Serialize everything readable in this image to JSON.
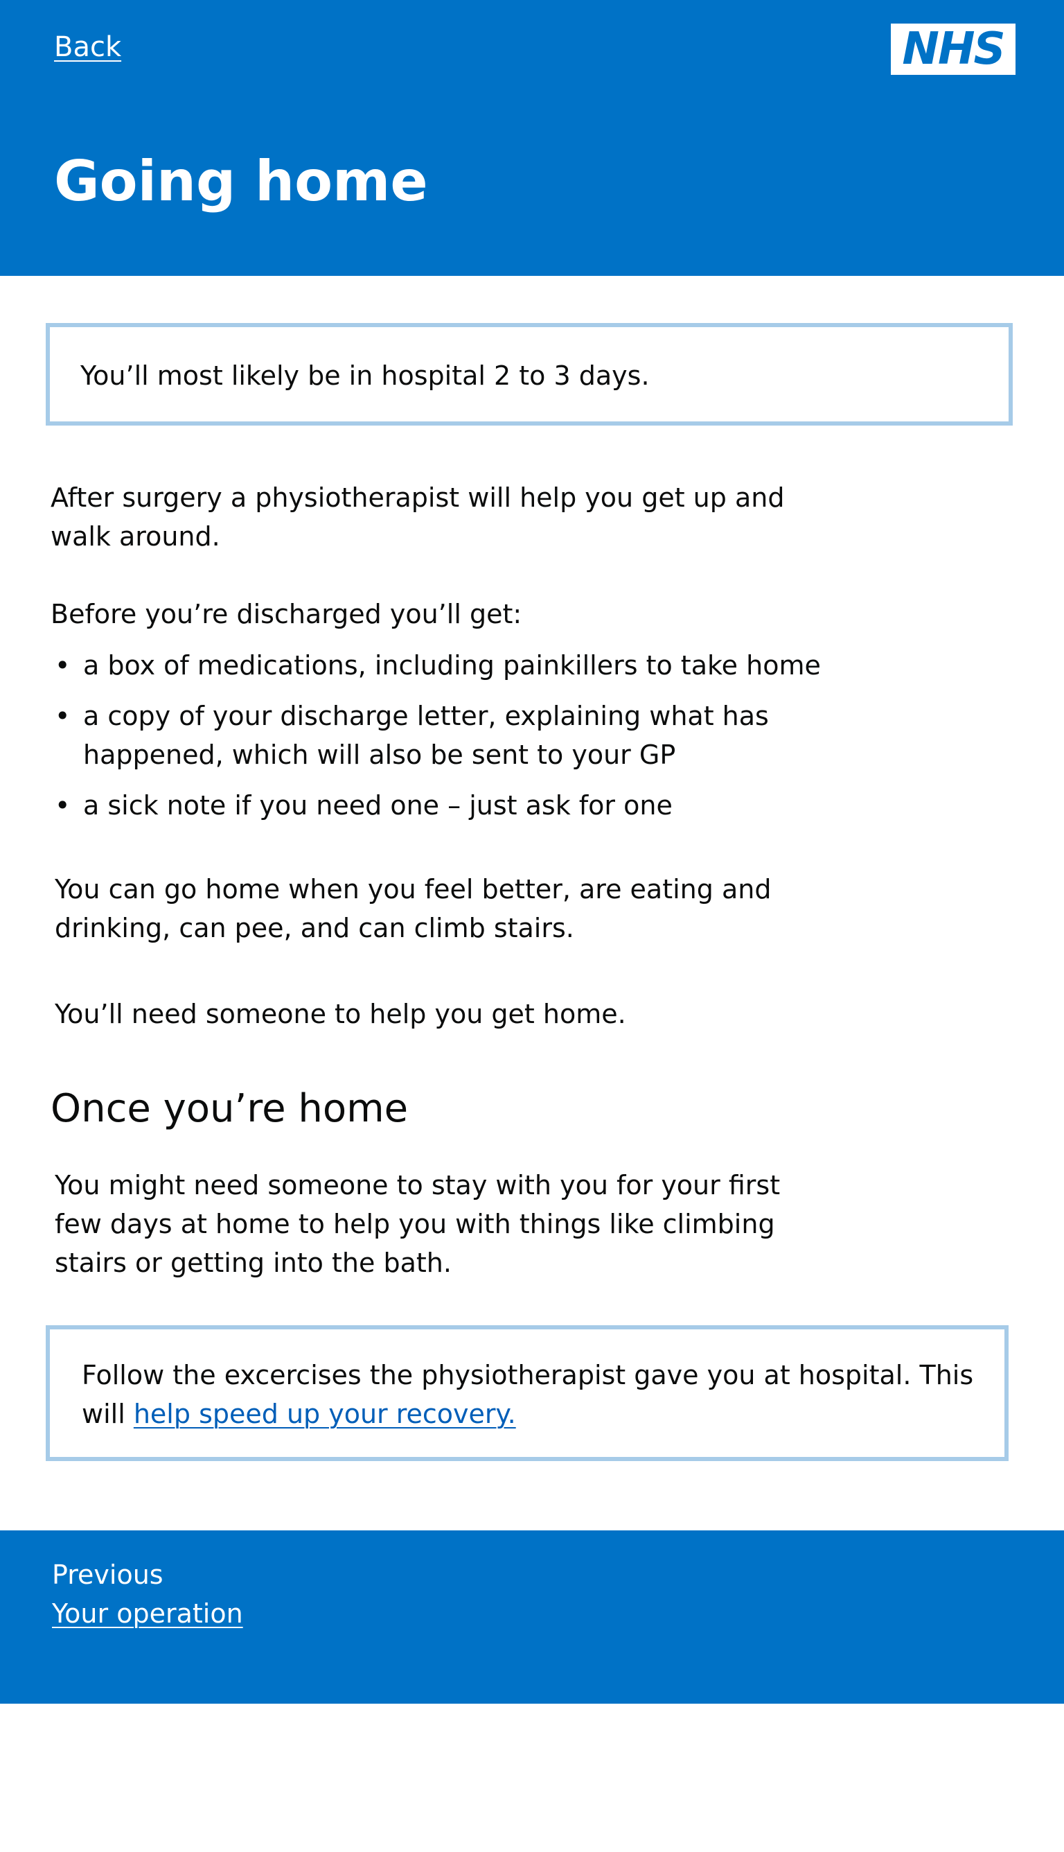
{
  "header": {
    "back_label": "Back",
    "logo_text": "NHS",
    "title": "Going home"
  },
  "inset_top": {
    "text": "You’ll most likely be in hospital 2 to 3 days."
  },
  "main": {
    "para_physio": "After surgery a physiotherapist will help you get up and walk around.",
    "discharge_intro": "Before you’re discharged you’ll get:",
    "discharge_items": [
      "a box of medications, including painkillers to take home",
      "a copy of your discharge letter, explaining what has happened, which will also be sent to your GP",
      "a sick note if you need one – just ask for one"
    ],
    "para_go_home": "You can go home when you feel better, are eating and drinking, can pee, and can climb stairs.",
    "para_need_someone": "You’ll need someone to help you get home.",
    "subheading": "Once you’re home",
    "para_stay": "You might need someone to stay with you for your first few days at home to help you with things like climbing stairs or getting into the bath."
  },
  "inset_bottom": {
    "text": "Follow the excercises the physiotherapist gave you at hospital. This will ",
    "link_label": "help speed up your recovery."
  },
  "footer_nav": {
    "previous_label": "Previous",
    "previous_link": "Your operation"
  },
  "colors": {
    "nhs_blue": "#0072c6",
    "inset_border": "#a6cbe8",
    "link": "#005eb8",
    "text": "#0b0c0c"
  }
}
